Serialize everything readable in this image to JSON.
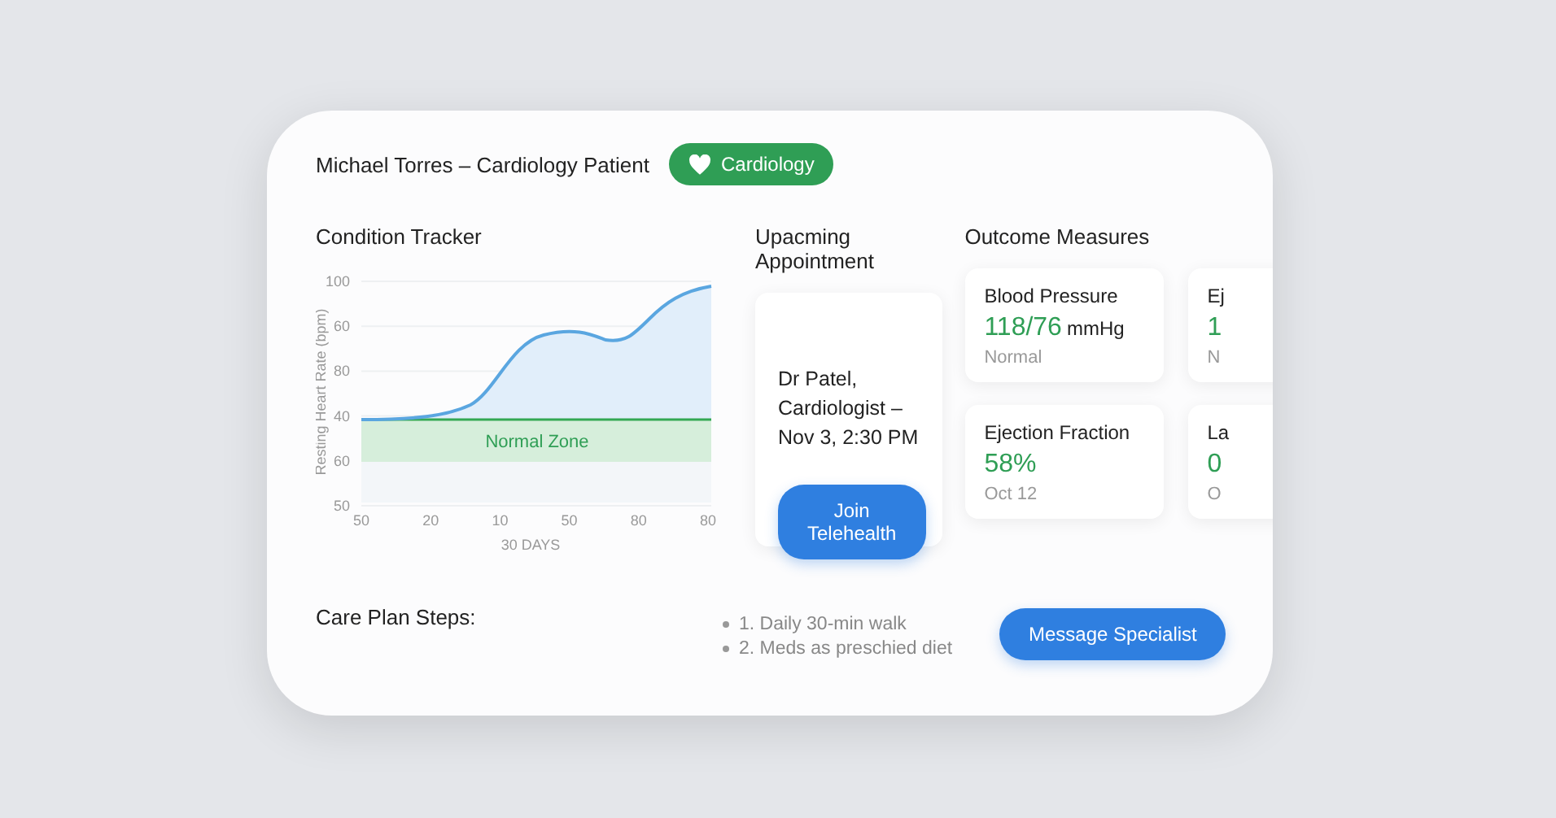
{
  "header": {
    "title": "Michael Torres – Cardiology Patient",
    "badge": "Cardiology"
  },
  "tracker": {
    "title": "Condition Tracker",
    "y_axis_label": "Resting Heart Rate (bpm)",
    "y_ticks": [
      "100",
      "60",
      "80",
      "40",
      "60",
      "50"
    ],
    "x_ticks": [
      "50",
      "20",
      "10",
      "50",
      "80",
      "80"
    ],
    "x_axis_label": "30 DAYS",
    "zone_label": "Normal Zone"
  },
  "appointment": {
    "title": "Upacming Appointment",
    "details": "Dr Patel, Cardiologist – Nov 3, 2:30 PM",
    "button": "Join Telehealth"
  },
  "outcomes": {
    "title": "Outcome Measures",
    "cards": [
      {
        "name": "Blood Pressure",
        "value": "118/76",
        "unit": "mmHg",
        "note": "Normal"
      },
      {
        "name": "Ej",
        "value": "1",
        "note": "N"
      },
      {
        "name": "Ejection Fraction",
        "value": "58%",
        "note": "Oct 12"
      },
      {
        "name": "La",
        "value": "0",
        "note": "O"
      }
    ]
  },
  "care_plan": {
    "title": "Care Plan Steps:",
    "steps": [
      "1. Daily 30-min walk",
      "2. Meds as preschied diet"
    ],
    "button": "Message Specialist"
  }
}
